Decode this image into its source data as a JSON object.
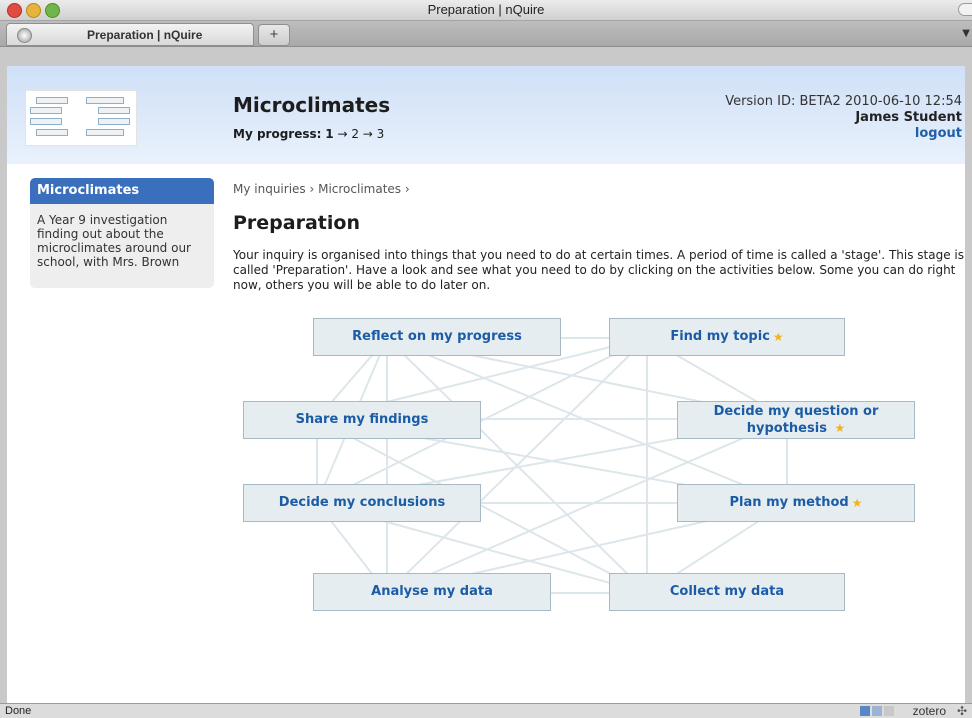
{
  "window": {
    "title": "Preparation | nQuire"
  },
  "tabs": [
    {
      "label": "Preparation | nQuire"
    }
  ],
  "new_tab_label": "+",
  "header": {
    "site_title": "Microclimates",
    "progress_label": "My progress:",
    "progress_current": "1",
    "progress_rest": "→ 2 → 3",
    "version": "Version ID: BETA2 2010-06-10 12:54",
    "user_name": "James Student",
    "logout": "logout"
  },
  "sidebar": {
    "title": "Microclimates",
    "description": "A Year 9 investigation finding out about the microclimates around our school, with Mrs. Brown"
  },
  "breadcrumb": "My inquiries › Microclimates ›",
  "page": {
    "title": "Preparation",
    "intro": "Your inquiry is organised into things that you need to do at certain times. A period of time is called a 'stage'. This stage is called 'Preparation'. Have a look and see what you need to do by clicking on the activities below. Some you can do right now, others you will be able to do later on."
  },
  "activities": {
    "reflect": {
      "label": "Reflect on my progress",
      "starred": false
    },
    "find_topic": {
      "label": "Find my topic",
      "starred": true
    },
    "share": {
      "label": "Share my findings",
      "starred": false
    },
    "decide_question": {
      "label": "Decide my question or hypothesis",
      "starred": true
    },
    "decide_conclusions": {
      "label": "Decide my conclusions",
      "starred": false
    },
    "plan_method": {
      "label": "Plan my method",
      "starred": true
    },
    "analyse": {
      "label": "Analyse my data",
      "starred": false
    },
    "collect": {
      "label": "Collect my data",
      "starred": false
    }
  },
  "status": {
    "text": "Done",
    "zotero": "zotero"
  },
  "colors": {
    "accent": "#1c5ca6",
    "sidebar_header": "#3a6fbd",
    "star": "#f2b21a"
  }
}
